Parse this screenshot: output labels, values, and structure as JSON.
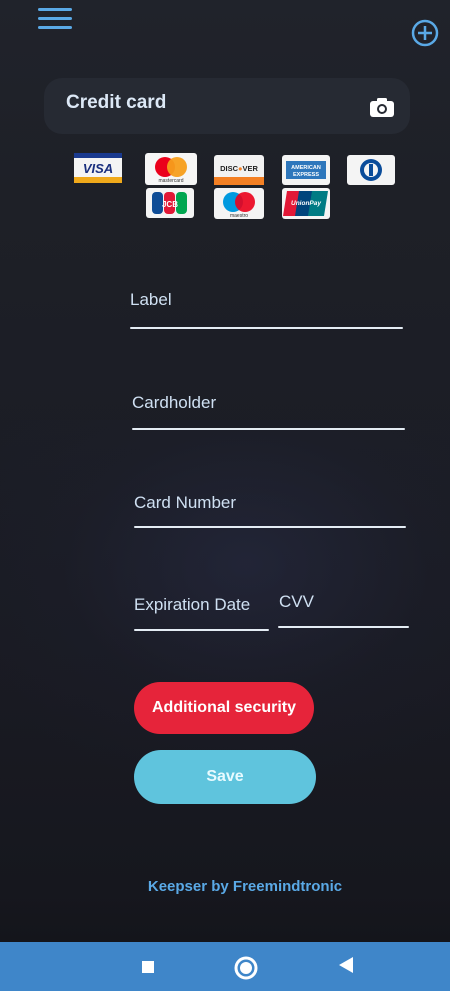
{
  "header": {
    "menu_icon": "menu-icon",
    "add_icon": "add-circle-icon"
  },
  "card_section": {
    "title": "Credit card",
    "camera_icon": "camera-icon",
    "logos": [
      {
        "name": "visa",
        "text": "VISA"
      },
      {
        "name": "mastercard",
        "text": "mastercard"
      },
      {
        "name": "discover",
        "text": "DISCOVER"
      },
      {
        "name": "american-express",
        "text": "AMERICAN EXPRESS"
      },
      {
        "name": "diners-club",
        "text": ""
      },
      {
        "name": "jcb",
        "text": "JCB"
      },
      {
        "name": "maestro",
        "text": "maestro"
      },
      {
        "name": "unionpay",
        "text": "UnionPay"
      }
    ]
  },
  "form": {
    "label": "Label",
    "cardholder": "Cardholder",
    "card_number": "Card Number",
    "expiration_date": "Expiration Date",
    "cvv": "CVV"
  },
  "buttons": {
    "additional_security": "Additional security",
    "save": "Save"
  },
  "footer": {
    "text": "Keepser by Freemindtronic"
  },
  "colors": {
    "accent_blue": "#5aa9e6",
    "security_red": "#e6243a",
    "save_cyan": "#5fc4dd",
    "nav_bar": "#3f86c9"
  },
  "nav": {
    "recents_icon": "square-icon",
    "home_icon": "circle-icon",
    "back_icon": "triangle-back-icon"
  }
}
